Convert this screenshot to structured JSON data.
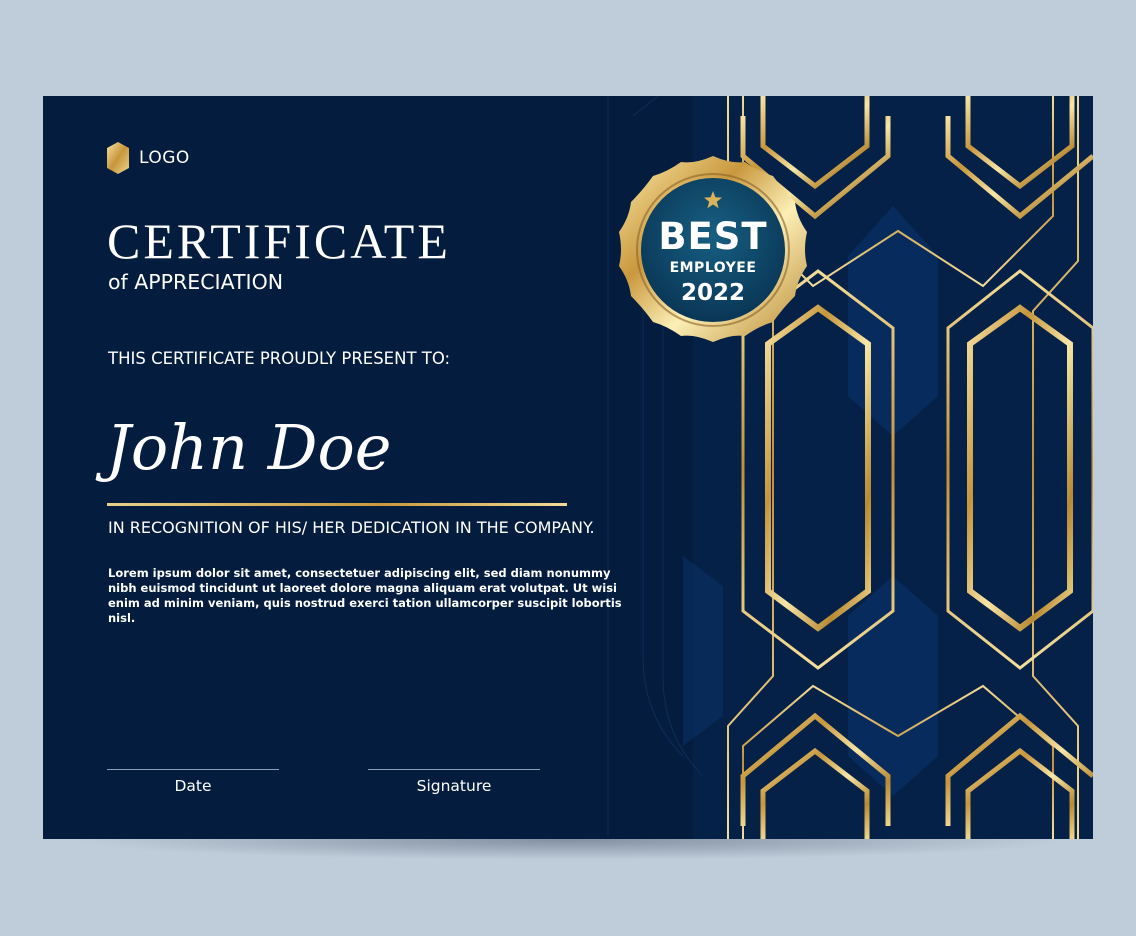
{
  "logo": {
    "text": "LOGO"
  },
  "certificate": {
    "title": "CERTIFICATE",
    "subtitle": "of APPRECIATION",
    "present_line": "THIS CERTIFICATE PROUDLY PRESENT TO:",
    "recipient_name": "John Doe",
    "recognition": "IN RECOGNITION OF HIS/ HER DEDICATION IN THE COMPANY.",
    "body_text": "Lorem ipsum dolor sit amet, consectetuer adipiscing elit, sed diam nonummy nibh euismod tincidunt ut laoreet dolore magna aliquam erat volutpat. Ut wisi enim ad minim veniam, quis nostrud exerci tation ullamcorper suscipit lobortis nisl."
  },
  "signatures": {
    "date_label": "Date",
    "signature_label": "Signature"
  },
  "badge": {
    "line1": "BEST",
    "line2": "EMPLOYEE",
    "line3": "2022",
    "icon": "star-icon"
  },
  "colors": {
    "page_background": "#bfccd9",
    "certificate_background": "#041c3e",
    "accent_gold": "#d9b45a",
    "badge_center": "#0d4a6b"
  }
}
